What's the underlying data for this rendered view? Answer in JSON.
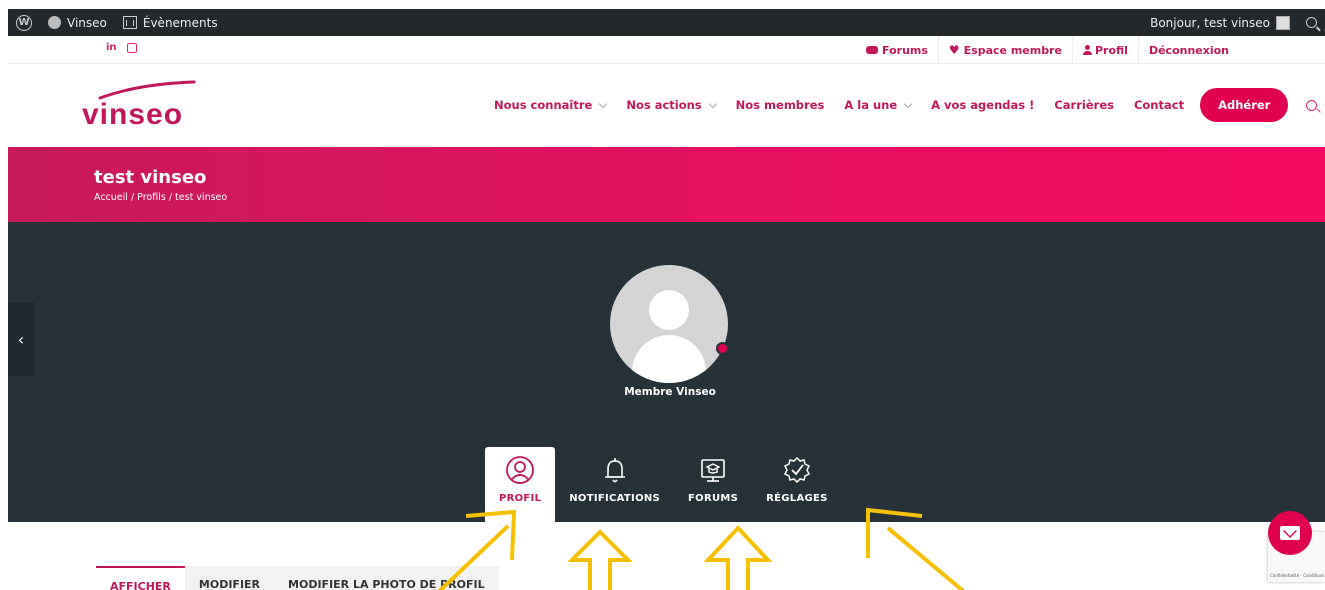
{
  "adminbar": {
    "site_name": "Vinseo",
    "events": "Évènements",
    "greeting": "Bonjour, test vinseo"
  },
  "topbar": {
    "social": {
      "linkedin": "in"
    },
    "links": [
      "Forums",
      "Espace membre",
      "Profil",
      "Déconnexion"
    ]
  },
  "header": {
    "logo_text": "vinseo",
    "nav": [
      "Nous connaître",
      "Nos actions",
      "Nos membres",
      "A la une",
      "A vos agendas !",
      "Carrières",
      "Contact"
    ],
    "cta": "Adhérer"
  },
  "title": {
    "heading": "test vinseo",
    "breadcrumb": "Accueil / Profils / test vinseo"
  },
  "profile": {
    "side_tab_glyph": "‹",
    "member_name": "Membre Vinseo",
    "status_color": "#e0004d",
    "tabs": [
      {
        "label": "PROFIL",
        "icon": "profile-icon",
        "active": true
      },
      {
        "label": "NOTIFICATIONS",
        "icon": "bell-icon",
        "active": false
      },
      {
        "label": "FORUMS",
        "icon": "forums-icon",
        "active": false
      },
      {
        "label": "RÉGLAGES",
        "icon": "settings-icon",
        "active": false
      }
    ]
  },
  "subtabs": [
    "AFFICHER",
    "MODIFIER",
    "MODIFIER LA PHOTO DE PROFIL"
  ],
  "recaptcha": {
    "label": "Confidentialité - Conditions"
  },
  "colors": {
    "accent": "#e0004d",
    "brand": "#c2185b",
    "dark_panel": "#263238",
    "admin_bar": "#23282d",
    "annotation_arrow": "#f5c000"
  }
}
